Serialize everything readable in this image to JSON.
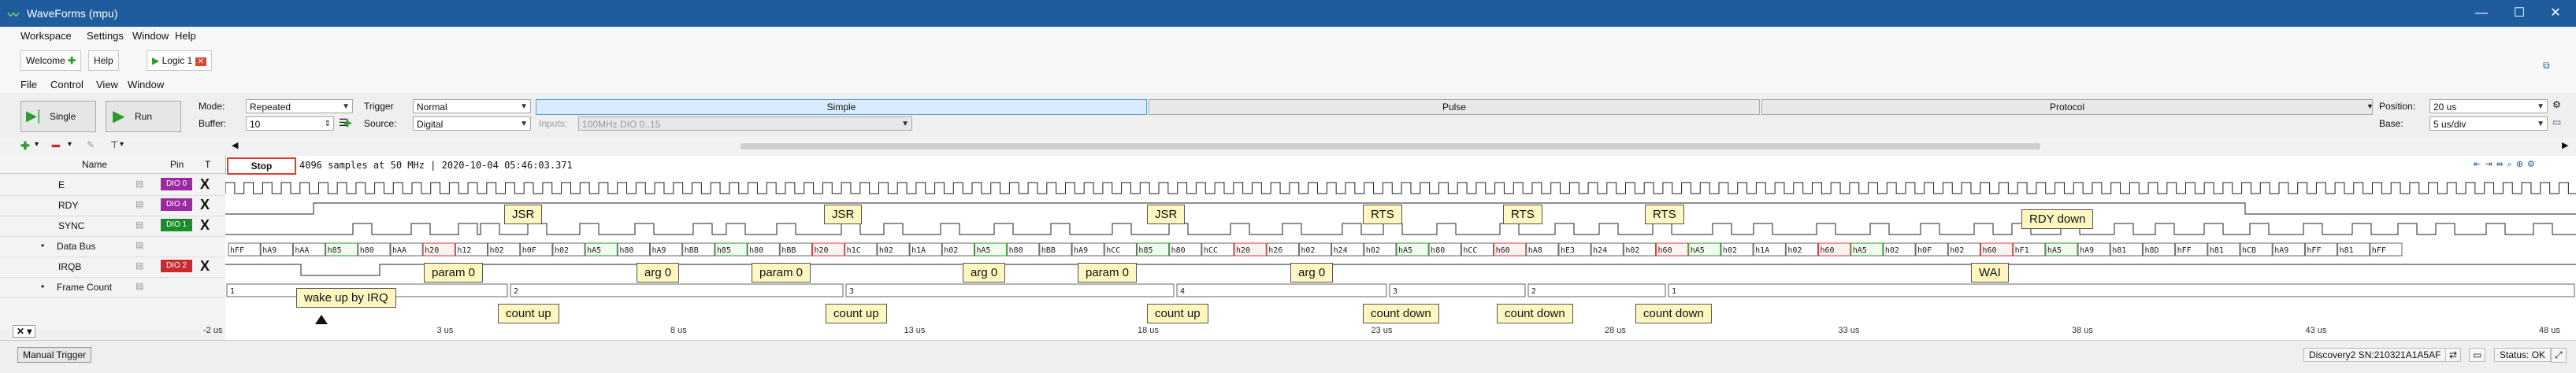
{
  "window": {
    "title": "WaveForms (mpu)",
    "min": "—",
    "max": "☐",
    "close": "✕"
  },
  "menu1": [
    "Workspace",
    "Settings",
    "Window",
    "Help"
  ],
  "tabs": {
    "welcome": "Welcome",
    "help": "Help",
    "logic": "Logic 1"
  },
  "menu2": [
    "File",
    "Control",
    "View",
    "Window"
  ],
  "toolbar": {
    "single_label": "Single",
    "run_label": "Run",
    "mode_label": "Mode:",
    "mode_value": "Repeated",
    "buffer_label": "Buffer:",
    "buffer_value": "10",
    "trigger_label": "Trigger",
    "trigger_value": "Normal",
    "source_label": "Source:",
    "source_value": "Digital",
    "inputs_label": "Inputs:",
    "inputs_value": "100MHz DIO 0..15",
    "tab_simple": "Simple",
    "tab_pulse": "Pulse",
    "tab_protocol": "Protocol",
    "position_label": "Position:",
    "position_value": "20 us",
    "base_label": "Base:",
    "base_value": "5 us/div"
  },
  "channels": {
    "header_name": "Name",
    "header_pin": "Pin",
    "header_t": "T",
    "rows": [
      {
        "name": "E",
        "pin": "DIO 0",
        "color": "#9b2aa0"
      },
      {
        "name": "RDY",
        "pin": "DIO 4",
        "color": "#9b2aa0"
      },
      {
        "name": "SYNC",
        "pin": "DIO 1",
        "color": "#1a8c2a"
      },
      {
        "name": "Data Bus",
        "pin": "",
        "color": "#1a8c2a"
      },
      {
        "name": "IRQB",
        "pin": "DIO 2",
        "color": "#c82b2b"
      },
      {
        "name": "Frame Count",
        "pin": "",
        "color": "#888888"
      }
    ]
  },
  "capture": {
    "stop_label": "Stop",
    "info": "4096 samples at 50 MHz | 2020-10-04 05:46:03.371"
  },
  "time_axis": {
    "ticks": [
      "-2 us",
      "3 us",
      "8 us",
      "13 us",
      "18 us",
      "23 us",
      "28 us",
      "33 us",
      "38 us",
      "43 us",
      "48 us"
    ]
  },
  "data_bus": [
    "hFF",
    "hA9",
    "hAA",
    "h85",
    "h80",
    "hAA",
    "h20",
    "h12",
    "h02",
    "h0F",
    "h02",
    "hA5",
    "h80",
    "hA9",
    "hBB",
    "h85",
    "h80",
    "hBB",
    "h20",
    "h1C",
    "h02",
    "h1A",
    "h02",
    "hA5",
    "h80",
    "hBB",
    "hA9",
    "hCC",
    "h85",
    "h80",
    "hCC",
    "h20",
    "h26",
    "h02",
    "h24",
    "h02",
    "hA5",
    "h80",
    "hCC",
    "h60",
    "hA8",
    "hE3",
    "h24",
    "h02",
    "h60",
    "hA5",
    "h02",
    "h1A",
    "h02",
    "h60",
    "hA5",
    "h02",
    "h0F",
    "h02",
    "h60",
    "hF1",
    "hA5",
    "hA9",
    "h81",
    "h8D",
    "hFF",
    "h81",
    "hCB",
    "hA9",
    "hFF",
    "h81",
    "hFF"
  ],
  "frame_count": [
    "1",
    "2",
    "3",
    "4",
    "3",
    "2",
    "1"
  ],
  "annotations": {
    "data_bus_callouts": [
      "JSR",
      "JSR",
      "JSR",
      "RTS",
      "RTS",
      "RTS",
      "RDY down"
    ],
    "param_callouts": [
      "param 0",
      "arg 0",
      "param 0",
      "arg 0",
      "param 0",
      "arg 0",
      "WAI"
    ],
    "count_callouts": [
      "count up",
      "count up",
      "count up",
      "count down",
      "count down",
      "count down"
    ],
    "irq_callout": "wake up by IRQ"
  },
  "status": {
    "manual_trigger": "Manual Trigger",
    "device": "Discovery2 SN:210321A1A5AF",
    "status": "Status: OK"
  }
}
